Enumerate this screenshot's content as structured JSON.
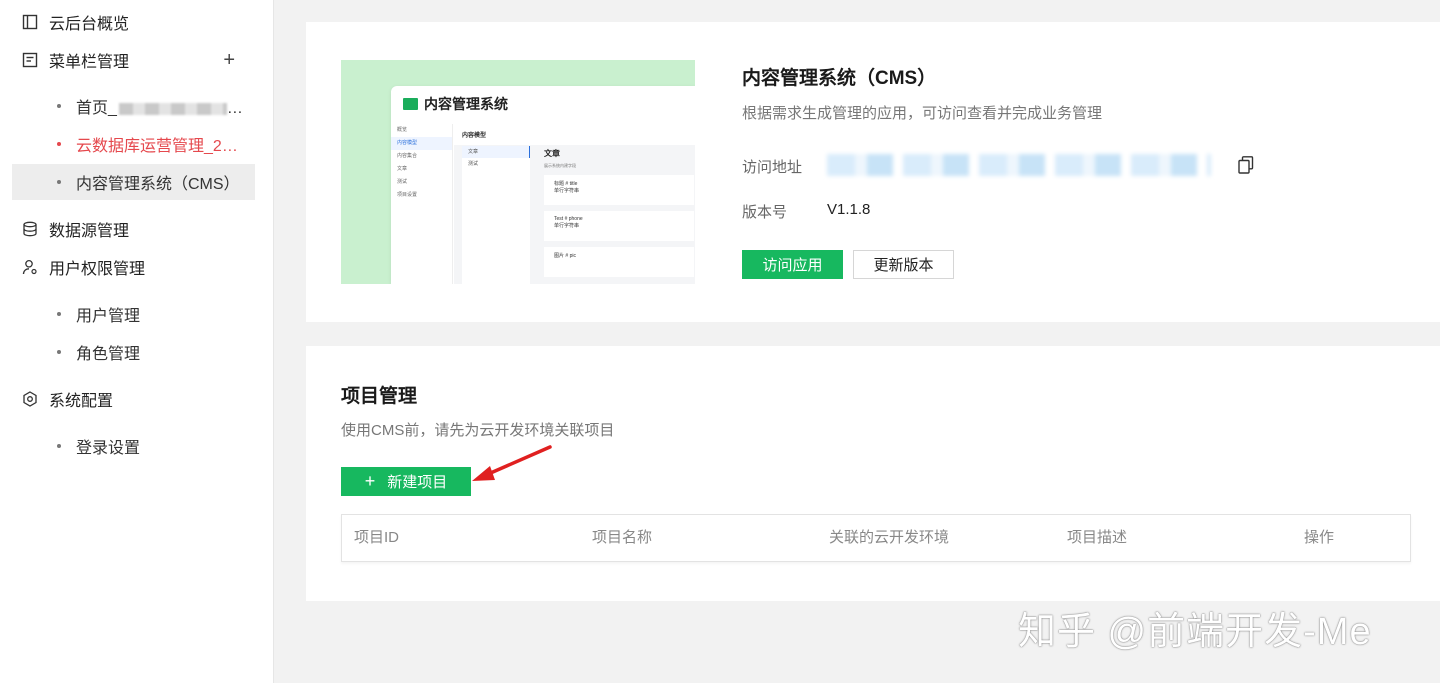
{
  "sidebar": {
    "overview": "云后台概览",
    "menu_mgmt": "菜单栏管理",
    "menu_items": [
      "首页_",
      "云数据库运营管理_20...",
      "内容管理系统（CMS）"
    ],
    "datasource": "数据源管理",
    "user_perm": "用户权限管理",
    "user_items": [
      "用户管理",
      "角色管理"
    ],
    "sys_config": "系统配置",
    "config_items": [
      "登录设置"
    ]
  },
  "app_card": {
    "title": "内容管理系统（CMS）",
    "description": "根据需求生成管理的应用，可访问查看并完成业务管理",
    "url_label": "访问地址",
    "version_label": "版本号",
    "version": "V1.1.8",
    "visit_button": "访问应用",
    "update_button": "更新版本",
    "preview": {
      "title": "内容管理系统",
      "nav": [
        "概览",
        "内容模型",
        "内容集合",
        "文章",
        "测试",
        "项目设置"
      ],
      "header": "内容模型",
      "models": [
        "文章",
        "测试"
      ],
      "model_title": "文章",
      "toggle_text": "展示系统内建字段",
      "fields": [
        {
          "name": "标题",
          "key": "# title",
          "tag": "单行字符串"
        },
        {
          "name": "Test",
          "key": "# phone",
          "tag": "单行字符串"
        },
        {
          "name": "图片",
          "key": "# pic"
        }
      ]
    }
  },
  "projects": {
    "title": "项目管理",
    "description": "使用CMS前，请先为云开发环境关联项目",
    "new_button": "新建项目",
    "columns": [
      "项目ID",
      "项目名称",
      "关联的云开发环境",
      "项目描述",
      "操作"
    ]
  },
  "watermark": "知乎 @前端开发-Me",
  "colors": {
    "primary": "#17b85f",
    "active_red": "#e5484d",
    "arrow": "#e02020"
  }
}
